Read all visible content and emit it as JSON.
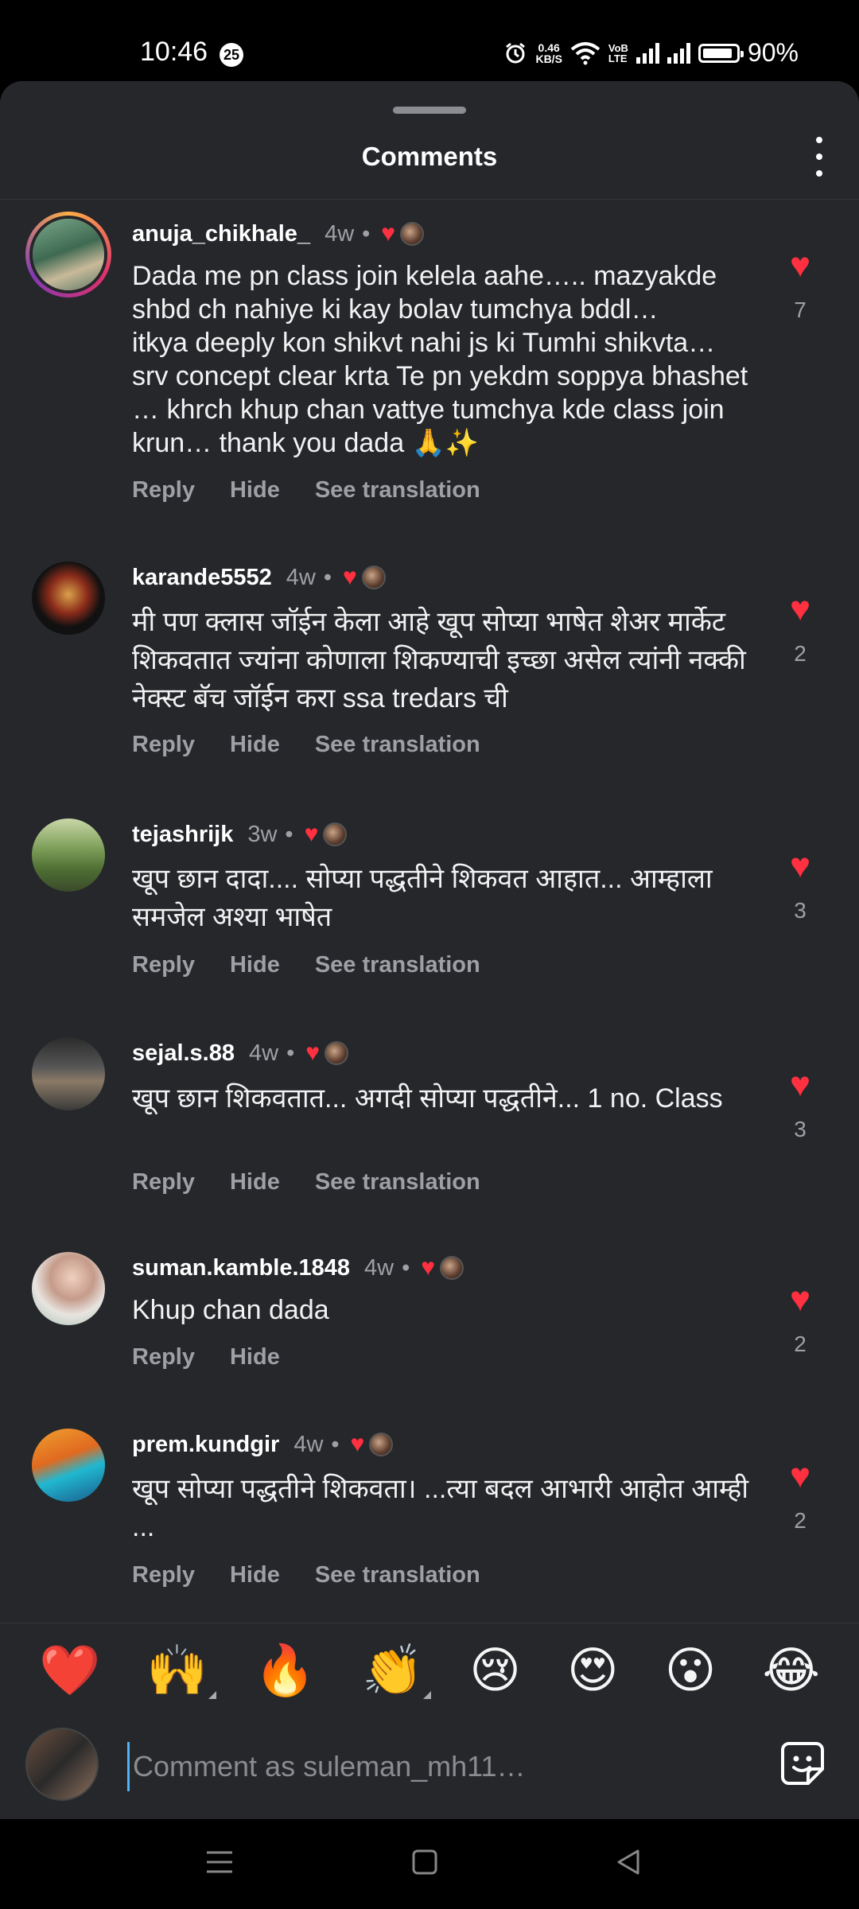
{
  "status_bar": {
    "time": "10:46",
    "notif_count": "25",
    "net_speed_value": "0.46",
    "net_speed_unit": "KB/S",
    "volte_top": "VoB",
    "volte_bottom": "LTE",
    "battery_percent": "90%",
    "battery_level": 0.9
  },
  "header": {
    "title": "Comments"
  },
  "comments": [
    {
      "user": "anuja_chikhale_",
      "time": "4w",
      "text": "Dada me pn class join kelela aahe….. mazyakde shbd ch nahiye ki kay bolav tumchya bddl…\nitkya deeply kon shikvt nahi js ki Tumhi shikvta…\nsrv concept clear krta Te pn yekdm soppya bhashet … khrch khup chan vattye tumchya kde class join krun… thank you dada 🙏✨",
      "likes": "7",
      "reply": "Reply",
      "hide": "Hide",
      "translate": "See translation"
    },
    {
      "user": "karande5552",
      "time": "4w",
      "text": "मी पण क्लास जॉईन केला आहे खूप सोप्या भाषेत शेअर मार्केट शिकवतात ज्यांना कोणाला शिकण्याची इच्छा असेल त्यांनी नक्की नेक्स्ट बॅच जॉईन करा ssa tredars ची",
      "likes": "2",
      "reply": "Reply",
      "hide": "Hide",
      "translate": "See translation"
    },
    {
      "user": "tejashrijk",
      "time": "3w",
      "text": "खूप छान दादा.... सोप्या पद्धतीने शिकवत आहात... आम्हाला समजेल अश्या भाषेत",
      "likes": "3",
      "reply": "Reply",
      "hide": "Hide",
      "translate": "See translation"
    },
    {
      "user": "sejal.s.88",
      "time": "4w",
      "text": "खूप छान शिकवतात... अगदी सोप्या पद्धतीने... 1 no. Class",
      "likes": "3",
      "reply": "Reply",
      "hide": "Hide",
      "translate": "See translation"
    },
    {
      "user": "suman.kamble.1848",
      "time": "4w",
      "text": "Khup chan dada",
      "likes": "2",
      "reply": "Reply",
      "hide": "Hide"
    },
    {
      "user": "prem.kundgir",
      "time": "4w",
      "text": "खूप सोप्या पद्धतीने शिकवता। ...त्या बदल आभारी आहोत आम्ही ...",
      "likes": "2",
      "reply": "Reply",
      "hide": "Hide",
      "translate": "See translation"
    }
  ],
  "emoji_bar": [
    "❤️",
    "🙌",
    "🔥",
    "👏",
    "😢",
    "😍",
    "😮",
    "😂"
  ],
  "composer": {
    "placeholder": "Comment as suleman_mh11…"
  },
  "icons": {
    "heart": "heart-icon",
    "more": "more-vertical-icon",
    "sticker": "sticker-icon",
    "nav_menu": "menu-icon",
    "nav_home": "square-home-icon",
    "nav_back": "back-triangle-icon"
  },
  "colors": {
    "heart": "#ff3040",
    "sheet_bg": "#25272b",
    "secondary_text": "#9ea0a5",
    "cursor": "#4fb3f5"
  }
}
